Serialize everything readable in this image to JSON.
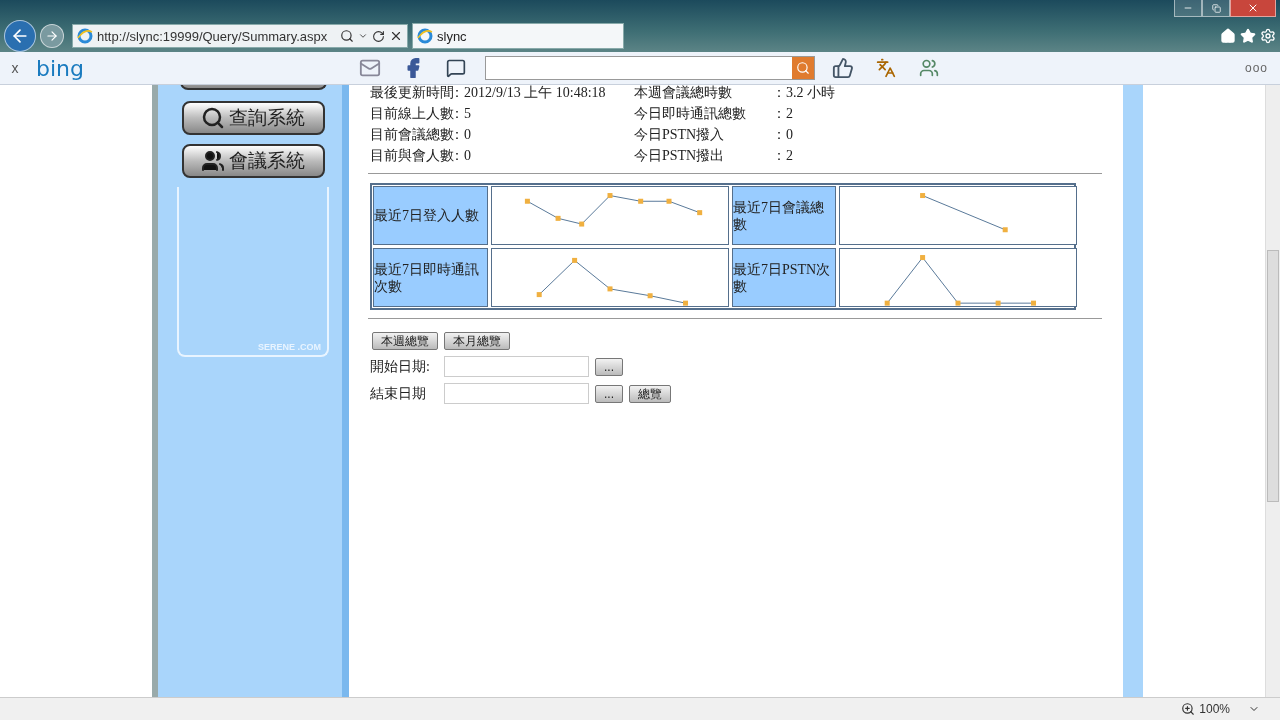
{
  "browser": {
    "address": "http://slync:19999/Query/Summary.aspx",
    "tabs": [
      {
        "label": "slync",
        "selected": true
      }
    ]
  },
  "toolbar": {
    "close": "x",
    "brand": "bing",
    "menu": "ooo"
  },
  "sidebar": {
    "items": [
      {
        "label": "查詢系統",
        "kind": "search"
      },
      {
        "label": "會議系統",
        "kind": "people"
      }
    ],
    "footer": "SERENE .COM"
  },
  "summary": [
    {
      "label": "最後更新時間",
      "value": "：2012/9/13 上午 10:48:18",
      "label2": "本週會議總時數",
      "value2": "：3.2 小時"
    },
    {
      "label": "目前線上人數",
      "value": "：5",
      "label2": "今日即時通訊總數",
      "value2": "：2"
    },
    {
      "label": "目前會議總數",
      "value": "：0",
      "label2": "今日PSTN撥入",
      "value2": "：0"
    },
    {
      "label": "目前與會人數",
      "value": "：0",
      "label2": "今日PSTN撥出",
      "value2": "：2"
    }
  ],
  "charts": [
    {
      "label": "最近7日登入人數"
    },
    {
      "label": "最近7日會議總數"
    },
    {
      "label": "最近7日即時通訊次數"
    },
    {
      "label": "最近7日PSTN次數"
    }
  ],
  "range_buttons": [
    "本週總覽",
    "本月總覽"
  ],
  "dates": [
    {
      "label": "開始日期:",
      "picker": "..."
    },
    {
      "label": "結束日期",
      "picker": "...",
      "submit": "總覽"
    }
  ],
  "status_bar": {
    "zoom": "100%"
  }
}
